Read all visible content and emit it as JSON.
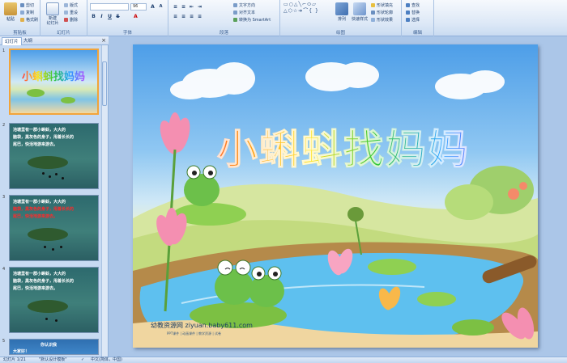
{
  "ribbon": {
    "groups": [
      {
        "id": "clipboard",
        "label": "剪贴板"
      },
      {
        "id": "slides",
        "label": "幻灯片"
      },
      {
        "id": "font",
        "label": "字体"
      },
      {
        "id": "paragraph",
        "label": "段落"
      },
      {
        "id": "drawing",
        "label": "绘图"
      },
      {
        "id": "editing",
        "label": "编辑"
      }
    ],
    "paste_label": "粘贴",
    "cut_label": "剪切",
    "copy_label": "复制",
    "format_painter_label": "格式刷",
    "new_slide_label": "新建\n幻灯片",
    "layout_label": "版式",
    "reset_label": "重设",
    "delete_label": "删除",
    "font_size": "96",
    "text_direction_label": "文字方向",
    "align_text_label": "对齐文本",
    "smartart_label": "转换为 SmartArt",
    "arrange_label": "排列",
    "quick_styles_label": "快速样式",
    "shape_fill_label": "形状填充",
    "shape_outline_label": "形状轮廓",
    "shape_effects_label": "形状效果",
    "find_label": "查找",
    "replace_label": "替换",
    "select_label": "选择"
  },
  "panel": {
    "tabs": [
      {
        "label": "幻灯片",
        "active": true
      },
      {
        "label": "大纲",
        "active": false
      }
    ],
    "close": "×",
    "slides": [
      {
        "num": "1",
        "lines": []
      },
      {
        "num": "2",
        "lines": [
          {
            "text": "池塘里有一群小蝌蚪，大大的",
            "red": false
          },
          {
            "text": "脑袋，黑灰色的身子，甩着长长的",
            "red": false
          },
          {
            "text": "尾巴，快活地游来游去。",
            "red": false
          }
        ]
      },
      {
        "num": "3",
        "lines": [
          {
            "text": "池塘里有一群小蝌蚪，大大的",
            "red": false
          },
          {
            "text": "脑袋，黑灰色的身子，甩着长长的",
            "red": true
          },
          {
            "text": "尾巴，快活地游来游去。",
            "red": true
          }
        ]
      },
      {
        "num": "4",
        "lines": [
          {
            "text": "池塘里有一群小蝌蚪，大大的",
            "red": false
          },
          {
            "text": "脑袋，黑灰色的身子，甩着长长的",
            "red": false
          },
          {
            "text": "尾巴，快活地游来游去。",
            "red": false
          }
        ]
      },
      {
        "num": "5",
        "lines": [
          {
            "text": "你认识我",
            "red": false
          },
          {
            "text": "大家好！",
            "red": false
          }
        ]
      }
    ]
  },
  "slide": {
    "title": "小蝌蚪找妈妈",
    "watermark": "幼教资源网 ziyuan.baby611.com",
    "watermark_sub": "PPT课件 | 动画课件 | 教学资源 | 试卷"
  },
  "status": {
    "slide_info": "幻灯片 1/21",
    "theme": "\"默认设计模板\"",
    "language": "中文(简体，中国)"
  },
  "colors": {
    "ribbon_bg": "#dbe7f6",
    "panel_bg": "#c7daf2",
    "selection": "#f2a43a"
  }
}
